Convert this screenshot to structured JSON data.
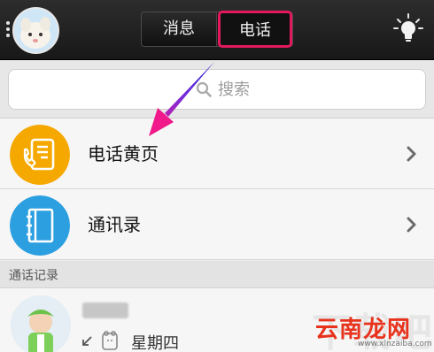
{
  "topbar": {
    "tabs": [
      {
        "label": "消息",
        "active": false
      },
      {
        "label": "电话",
        "active": true
      }
    ],
    "highlight_color": "#e3195c"
  },
  "search": {
    "placeholder": "搜索"
  },
  "rows": [
    {
      "label": "电话黄页",
      "icon": "phone-book-icon",
      "color": "#f5a800"
    },
    {
      "label": "通讯录",
      "icon": "contacts-icon",
      "color": "#2b9fe0"
    }
  ],
  "call_log": {
    "header": "通话记录",
    "entries": [
      {
        "time": "星期四"
      }
    ]
  },
  "watermark": {
    "logo": "云南龙网",
    "url": "www.xlnzaiba.com"
  }
}
